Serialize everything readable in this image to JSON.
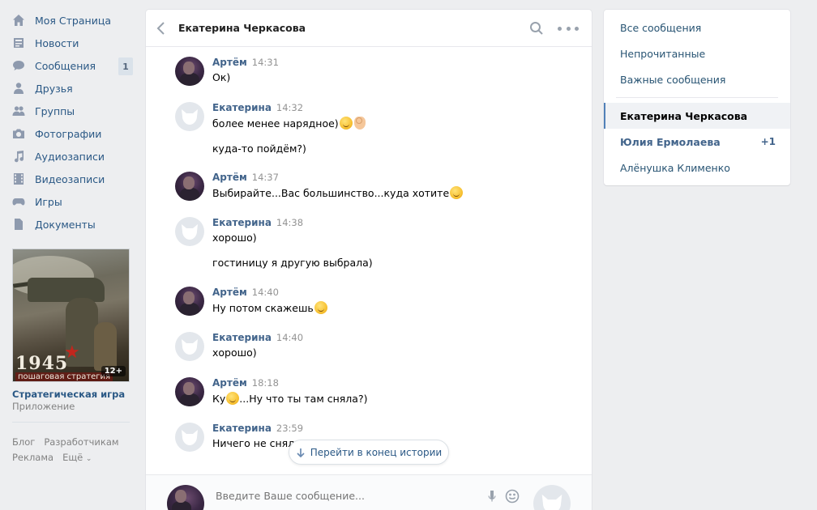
{
  "nav": {
    "items": [
      {
        "label": "Моя Страница",
        "icon": "home-icon"
      },
      {
        "label": "Новости",
        "icon": "news-icon"
      },
      {
        "label": "Сообщения",
        "icon": "messages-icon",
        "count": "1"
      },
      {
        "label": "Друзья",
        "icon": "friends-icon"
      },
      {
        "label": "Группы",
        "icon": "groups-icon"
      },
      {
        "label": "Фотографии",
        "icon": "camera-icon"
      },
      {
        "label": "Аудиозаписи",
        "icon": "music-icon"
      },
      {
        "label": "Видеозаписи",
        "icon": "video-icon"
      },
      {
        "label": "Игры",
        "icon": "gamepad-icon"
      },
      {
        "label": "Документы",
        "icon": "document-icon"
      }
    ]
  },
  "ad": {
    "image_year": "1945",
    "image_subtitle": "пошаговая стратегия",
    "age_rating": "12+",
    "title": "Стратегическая игра",
    "type": "Приложение"
  },
  "footer": {
    "links_row1": [
      "Блог",
      "Разработчикам"
    ],
    "links_row2": [
      "Реклама",
      "Ещё"
    ]
  },
  "chat": {
    "title": "Екатерина Черкасова",
    "messages": [
      {
        "author": "Артём",
        "time": "14:31",
        "avatar": "user",
        "lines": [
          {
            "text": "Ок)",
            "emojis": []
          }
        ]
      },
      {
        "author": "Екатерина",
        "time": "14:32",
        "avatar": "dog",
        "lines": [
          {
            "text": "более менее нарядное)",
            "emojis": [
              "smile",
              "ok-hand"
            ]
          },
          {
            "text": "куда-то пойдём?)",
            "emojis": []
          }
        ]
      },
      {
        "author": "Артём",
        "time": "14:37",
        "avatar": "user",
        "lines": [
          {
            "text": "Выбирайте...Вас большинство...куда хотите",
            "emojis": [
              "smile"
            ]
          }
        ]
      },
      {
        "author": "Екатерина",
        "time": "14:38",
        "avatar": "dog",
        "lines": [
          {
            "text": "хорошо)",
            "emojis": []
          },
          {
            "text": "гостиницу я другую выбрала)",
            "emojis": []
          }
        ]
      },
      {
        "author": "Артём",
        "time": "14:40",
        "avatar": "user",
        "lines": [
          {
            "text": "Ну потом скажешь",
            "emojis": [
              "smile"
            ]
          }
        ]
      },
      {
        "author": "Екатерина",
        "time": "14:40",
        "avatar": "dog",
        "lines": [
          {
            "text": "хорошо)",
            "emojis": []
          }
        ]
      },
      {
        "author": "Артём",
        "time": "18:18",
        "avatar": "user",
        "lines": [
          {
            "text": "Ку",
            "emojis": [
              "wink"
            ],
            "after": "...Ну что ты там сняла?)"
          }
        ]
      },
      {
        "author": "Екатерина",
        "time": "23:59",
        "avatar": "dog",
        "lines": [
          {
            "text": "Ничего не сняла",
            "emojis": []
          }
        ]
      }
    ],
    "scroll_to_end": "Перейти в конец истории",
    "input_placeholder": "Введите Ваше сообщение..."
  },
  "right_panel": {
    "filters": [
      "Все сообщения",
      "Непрочитанные",
      "Важные сообщения"
    ],
    "conversations": [
      {
        "name": "Екатерина Черкасова",
        "state": "active",
        "badge": ""
      },
      {
        "name": "Юлия Ермолаева",
        "state": "unread",
        "badge": "+1"
      },
      {
        "name": "Алёнушка Клименко",
        "state": "normal",
        "badge": ""
      }
    ]
  },
  "colors": {
    "background": "#edeef0",
    "link": "#2a5885",
    "author": "#42648b",
    "accent": "#5181b8"
  }
}
